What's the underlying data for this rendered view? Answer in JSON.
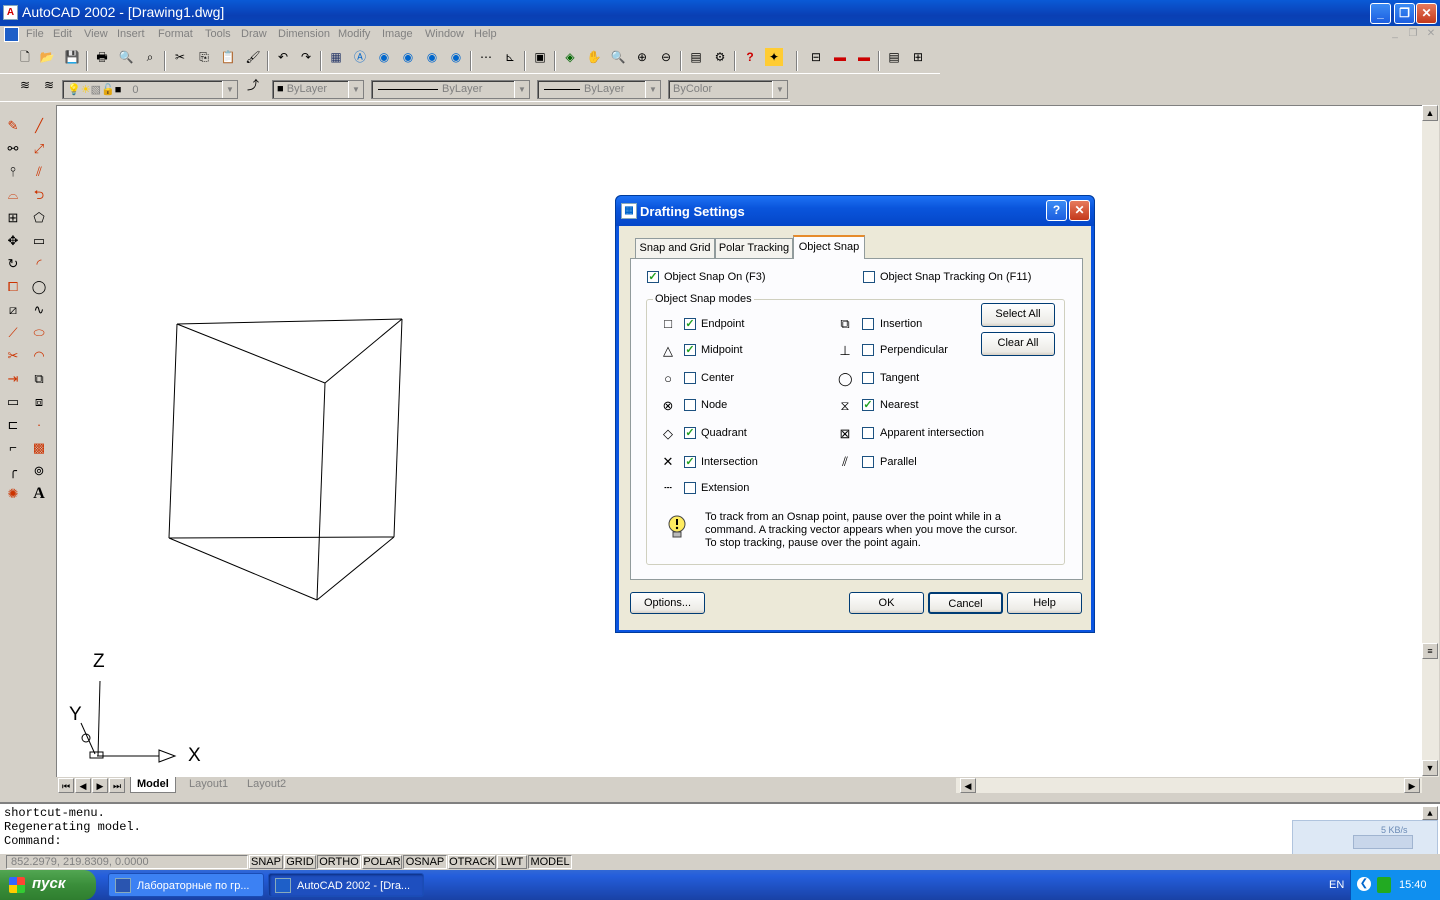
{
  "window": {
    "title": "AutoCAD 2002 - [Drawing1.dwg]",
    "minimize": "_",
    "maximize": "❐",
    "close": "✕"
  },
  "menu": [
    "File",
    "Edit",
    "View",
    "Insert",
    "Format",
    "Tools",
    "Draw",
    "Dimension",
    "Modify",
    "Image",
    "Window",
    "Help"
  ],
  "properties_bar": {
    "layer": "0",
    "color": "ByLayer",
    "linetype": "ByLayer",
    "lineweight": "ByLayer",
    "plotstyle": "ByColor"
  },
  "ucs": {
    "x": "X",
    "y": "Y",
    "z": "Z"
  },
  "layout_tabs": [
    "Model",
    "Layout1",
    "Layout2"
  ],
  "command_lines": [
    "shortcut-menu.",
    "Regenerating model.",
    "Command:"
  ],
  "status": {
    "coords": "852.2979, 219.8309, 0.0000",
    "toggles": [
      "SNAP",
      "GRID",
      "ORTHO",
      "POLAR",
      "OSNAP",
      "OTRACK",
      "LWT",
      "MODEL"
    ],
    "on": [
      "ORTHO",
      "OSNAP",
      "MODEL"
    ]
  },
  "network_widget": {
    "speed": "5 KB/s"
  },
  "taskbar": {
    "start": "пуск",
    "tasks": [
      "Лабораторные по гр...",
      "AutoCAD 2002 - [Dra..."
    ],
    "lang": "EN",
    "time": "15:40"
  },
  "dialog": {
    "title": "Drafting Settings",
    "tabs": [
      "Snap and Grid",
      "Polar Tracking",
      "Object Snap"
    ],
    "active_tab": "Object Snap",
    "osnap_on_label": "Object Snap On (F3)",
    "osnap_on": true,
    "tracking_label": "Object Snap Tracking On (F11)",
    "tracking_on": false,
    "group_label": "Object Snap modes",
    "modes_left": [
      {
        "label": "Endpoint",
        "checked": true,
        "symbol": "□"
      },
      {
        "label": "Midpoint",
        "checked": true,
        "symbol": "△"
      },
      {
        "label": "Center",
        "checked": false,
        "symbol": "○"
      },
      {
        "label": "Node",
        "checked": false,
        "symbol": "⊗"
      },
      {
        "label": "Quadrant",
        "checked": true,
        "symbol": "◇"
      },
      {
        "label": "Intersection",
        "checked": true,
        "symbol": "✕"
      },
      {
        "label": "Extension",
        "checked": false,
        "symbol": "┄"
      }
    ],
    "modes_right": [
      {
        "label": "Insertion",
        "checked": false,
        "symbol": "⧉"
      },
      {
        "label": "Perpendicular",
        "checked": false,
        "symbol": "⊥"
      },
      {
        "label": "Tangent",
        "checked": false,
        "symbol": "◯"
      },
      {
        "label": "Nearest",
        "checked": true,
        "symbol": "⧖"
      },
      {
        "label": "Apparent intersection",
        "checked": false,
        "symbol": "⊠"
      },
      {
        "label": "Parallel",
        "checked": false,
        "symbol": "⫽"
      }
    ],
    "select_all": "Select All",
    "clear_all": "Clear All",
    "hint": [
      "To track from an Osnap point, pause over the point while in a",
      "command.  A tracking vector appears when you move the cursor.",
      "To stop tracking, pause over the point again."
    ],
    "options": "Options...",
    "ok": "OK",
    "cancel": "Cancel",
    "help": "Help"
  }
}
